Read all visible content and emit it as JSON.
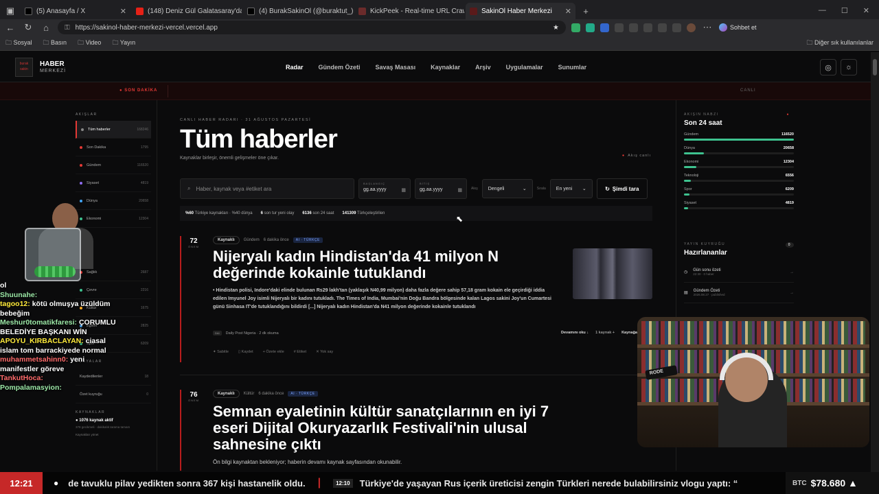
{
  "browser": {
    "tabs": [
      {
        "label": "(5) Anasayfa / X",
        "color": "#222222"
      },
      {
        "label": "(148) Deniz Gül Galatasaray'da?..",
        "color": "#e62117"
      },
      {
        "label": "(4) BurakSakinOl (@buraktut_) / X",
        "color": "#222222"
      },
      {
        "label": "KickPeek - Real-time URL Crawler",
        "color": "#6b2b2b"
      },
      {
        "label": "SakinOl Haber Merkezi",
        "color": "#5a1a1a"
      }
    ],
    "url": "https://sakinol-haber-merkezi-vercel.vercel.app",
    "profile_button": "Sohbet et",
    "bookmarks": [
      "Sosyal",
      "Basın",
      "Video",
      "Yayın"
    ],
    "other_bookmarks": "Diğer sık kullanılanlar"
  },
  "site": {
    "logo_text": "burak sakin",
    "brand_top": "HABER",
    "brand_bottom": "MERKEZİ",
    "nav": [
      "Radar",
      "Gündem Özeti",
      "Savaş Masası",
      "Kaynaklar",
      "Arşiv",
      "Uygulamalar",
      "Sunumlar"
    ],
    "breaking_label": "SON DAKİKA",
    "breaking_right": "CANLI"
  },
  "left_sidebar": {
    "heading": "AKIŞLAR",
    "items": [
      {
        "label": "Tüm haberler",
        "count": "168246",
        "color": "#888888"
      },
      {
        "label": "Son Dakika",
        "count": "1795",
        "color": "#e53935"
      },
      {
        "label": "Gündem",
        "count": "116520",
        "color": "#e53935"
      },
      {
        "label": "Siyaset",
        "count": "4819",
        "color": "#8e6cf0"
      },
      {
        "label": "Dünya",
        "count": "20658",
        "color": "#42a5f5"
      },
      {
        "label": "Ekonomi",
        "count": "12304",
        "color": "#3ec28f"
      }
    ],
    "items_lower": [
      {
        "label": "Sağlık",
        "count": "2687",
        "color": "#e53935"
      },
      {
        "label": "Çevre",
        "count": "2216",
        "color": "#3ec28f"
      },
      {
        "label": "Kültür",
        "count": "1675",
        "color": "#f5a623"
      },
      {
        "label": "Eğitim",
        "count": "2825",
        "color": "#42a5f5"
      },
      {
        "label": "Spor",
        "count": "6209",
        "color": "#3ec28f"
      }
    ],
    "files_heading": "DOSYALAR",
    "files": [
      {
        "label": "Kaydedilenler",
        "count": "18"
      },
      {
        "label": "Özet kuyruğu",
        "count": "0"
      }
    ],
    "sources_heading": "KAYNAKLAR",
    "sources_active": "1076 kaynak aktif",
    "sources_note": "378 gecikmeli · dakikalık tarama tamam",
    "sources_link": "Kaynakları yönet"
  },
  "center": {
    "kicker": "CANLI HABER RADARI · 31 AĞUSTOS PAZARTESİ",
    "title": "Tüm haberler",
    "subtitle": "Kaynaklar birleşir, önemli gelişmeler öne çıkar.",
    "live_label": "Akış canlı",
    "search_placeholder": "Haber, kaynak veya #etiket ara",
    "date_start_label": "BAŞLANGIÇ",
    "date_end_label": "BİTİŞ",
    "date_placeholder": "gg.aa.yyyy",
    "mode_label": "Akış",
    "mode_value": "Dengeli",
    "sort_label": "Sırala",
    "sort_value": "En yeni",
    "scan_button": "Şimdi tara",
    "stats": [
      {
        "value": "%60",
        "label": "Türkiye kaynakları · %40 dünya"
      },
      {
        "value": "6",
        "label": "son tur yeni olay"
      },
      {
        "value": "6136",
        "label": "son 24 saat"
      },
      {
        "value": "141309",
        "label": "Türkçeleştirilen"
      }
    ]
  },
  "articles": [
    {
      "score": "72",
      "score_label": "ÖNEM",
      "source_pill": "Kaynaklı",
      "category": "Gündem",
      "time": "6 dakika önce",
      "ai_tag": "AI · TÜRKÇE",
      "headline_1": "Nijeryalı kadın Hindistan'da 41 milyon N",
      "headline_2": "değerinde kokainle tutuklandı",
      "summary": "Hindistan polisi, Indore'daki elinde bulunan Rs29 lakh'tan (yaklaşık N40,99 milyon) daha fazla değere sahip 57,18 gram kokain ele geçirdiği iddia edilen Imyunel Joy isimli Nijeryalı bir kadını tutukladı. The Times of India, Mumbai'nin Doğu Bandra bölgesinde kalan Lagos sakini Joy'un Cumartesi günü Sinhasa IT'de tutuklandığını bildirdi [...] Nijeryalı kadın Hindistan'da N41 milyon değerinde kokainle tutuklandı",
      "source_badge": "DAI",
      "source": "Daily Post Nigeria · 2 dk okuma",
      "read_more": "Devamını oku ↓",
      "source_count": "1 kaynak +",
      "source_link": "Kaynağa",
      "actions": [
        "Sabitle",
        "Kaydet",
        "Özete ekle",
        "Etiket",
        "Yok say"
      ]
    },
    {
      "score": "76",
      "score_label": "ÖNEM",
      "source_pill": "Kaynaklı",
      "category": "Kültür",
      "time": "6 dakika önce",
      "ai_tag": "AI · TÜRKÇE",
      "headline_1": "Semnan eyaletinin kültür sanatçılarının en iyi 7",
      "headline_2": "eseri Dijital Okuryazarlık Festivali'nin ulusal",
      "headline_3": "sahnesine çıktı",
      "summary": "Ön bilgi kaynaktan bekleniyor; haberin devamı kaynak sayfasından okunabilir."
    }
  ],
  "right_sidebar": {
    "heading": "AKIŞIN NABZI",
    "title": "Son 24 saat",
    "bars": [
      {
        "label": "Gündem",
        "value": "116520",
        "fraction": 1.0
      },
      {
        "label": "Dünya",
        "value": "20658",
        "fraction": 0.18
      },
      {
        "label": "Ekonomi",
        "value": "12304",
        "fraction": 0.11
      },
      {
        "label": "Teknoloji",
        "value": "6556",
        "fraction": 0.06
      },
      {
        "label": "Spor",
        "value": "6209",
        "fraction": 0.05
      },
      {
        "label": "Siyaset",
        "value": "4819",
        "fraction": 0.04
      }
    ],
    "queue_heading": "YAYIN KUYRUĞU",
    "queue_count": "0",
    "queue_title": "Hazırlananlar",
    "queue_items": [
      {
        "title": "Gün sonu özeti",
        "sub": "22:30 · 0 haber"
      },
      {
        "title": "Gündem Özeti",
        "sub": "2026.08.27 · published"
      }
    ]
  },
  "chat": [
    {
      "user": "",
      "msg": "ol"
    },
    {
      "user": "Shuunahe:",
      "msg": ""
    },
    {
      "user": "tagoo12:",
      "msg": "kötü olmuşya üzüldüm bebeğim"
    },
    {
      "user": "Meshur0tomatikfaresi:",
      "msg": "ÇORUMLU BELEDİYE BAŞKANI WİN"
    },
    {
      "user": "APOYU_KIRBACLAYAN:",
      "msg": "ciasal islam tom barrackiyede normal"
    },
    {
      "user": "muhammetsahinn0:",
      "msg": "yeni manifestler göreve"
    },
    {
      "user": "TankutHoca:",
      "msg": ""
    },
    {
      "user": "Pompalamasyion:",
      "msg": ""
    }
  ],
  "webcam": {
    "mic_brand": "RODE"
  },
  "ticker": {
    "clock": "12:21",
    "item_1": "de tavuklu pilav yedikten sonra 367 kişi hastanelik oldu.",
    "time_2": "12:10",
    "item_2": "Türkiye'de yaşayan Rus içerik üreticisi zengin Türkleri nerede bulabilirsiniz vlogu yaptı: “",
    "btc_label": "BTC",
    "btc_value": "$78.680 ▲"
  }
}
